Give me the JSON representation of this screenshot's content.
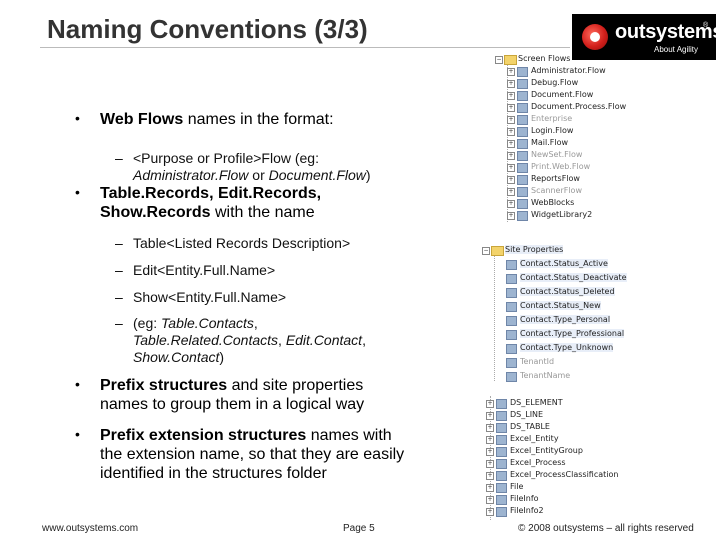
{
  "slide": {
    "title": "Naming Conventions (3/3)",
    "logo": {
      "name": "outsystems",
      "reg": "®",
      "tagline": "About Agility"
    },
    "bullets": [
      {
        "bold": "Web Flows",
        "rest": " names in the format:"
      },
      {
        "bold": "Table.Records, Edit.Records, Show.Records",
        "rest": " with the name"
      },
      {
        "bold": "Prefix structures",
        "rest": " and site properties names to group them in a logical way"
      },
      {
        "bold": "Prefix extension structures",
        "rest": " names with the extension name, so that they are easily identified in the structures folder"
      }
    ],
    "sub1": {
      "a": "<Purpose or Profile>Flow (eg:",
      "b": "Administrator.Flow",
      "c": " or ",
      "d": "Document.Flow",
      "e": ")"
    },
    "sub2": [
      "Table<Listed Records Description>",
      "Edit<Entity.Full.Name>",
      "Show<Entity.Full.Name>"
    ],
    "sub3": {
      "a": "(eg: ",
      "b": "Table.Contacts",
      "c": ",",
      "d": "Table.Related.Contacts",
      "e": ", ",
      "f": "Edit.Contact",
      "g": ",",
      "h": "Show.Contact",
      "i": ")"
    },
    "dash": "–",
    "dot": "•",
    "tree1": {
      "root": "Screen Flows",
      "items": [
        "Administrator.Flow",
        "Debug.Flow",
        "Document.Flow",
        "Document.Process.Flow",
        "Enterprise",
        "Login.Flow",
        "Mail.Flow",
        "NewSet.Flow",
        "Print.Web.Flow",
        "ReportsFlow",
        "ScannerFlow",
        "WebBlocks",
        "WidgetLibrary2"
      ]
    },
    "tree2": {
      "root": "Site Properties",
      "items": [
        "Contact.Status_Active",
        "Contact.Status_Deactivate",
        "Contact.Status_Deleted",
        "Contact.Status_New",
        "Contact.Type_Personal",
        "Contact.Type_Professional",
        "Contact.Type_Unknown",
        "TenantId",
        "TenantName"
      ]
    },
    "tree3": {
      "items": [
        "DS_ELEMENT",
        "DS_LINE",
        "DS_TABLE",
        "Excel_Entity",
        "Excel_EntityGroup",
        "Excel_Process",
        "Excel_ProcessClassification",
        "File",
        "FileInfo",
        "FileInfo2"
      ]
    },
    "footer": {
      "left": "www.outsystems.com",
      "center": "Page 5",
      "right": "© 2008 outsystems – all rights reserved"
    }
  }
}
